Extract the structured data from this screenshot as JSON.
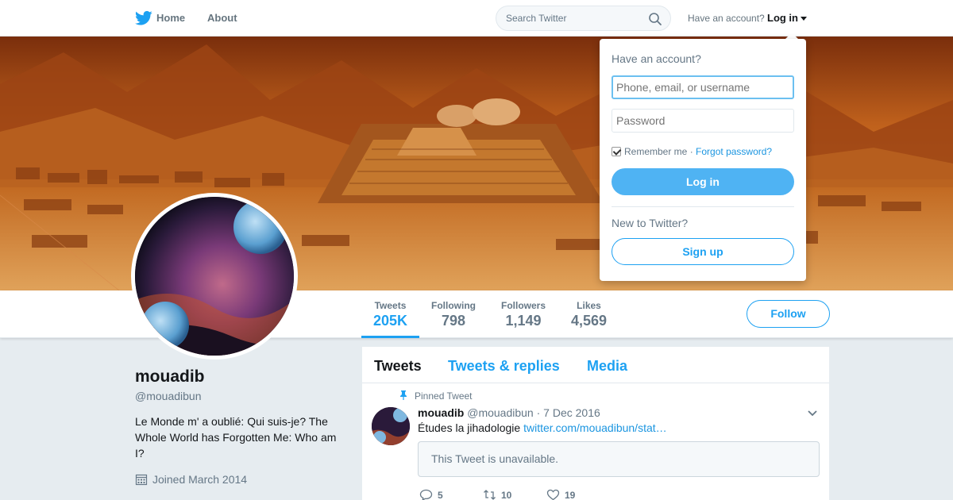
{
  "nav": {
    "home_label": "Home",
    "about_label": "About",
    "search_placeholder": "Search Twitter",
    "have_account": "Have an account?",
    "login_label": "Log in"
  },
  "profile": {
    "name": "mouadib",
    "handle": "@mouadibun",
    "bio": "Le Monde m' a oublié: Qui suis-je? The Whole World has Forgotten Me: Who am I?",
    "joined": "Joined March 2014",
    "follow_label": "Follow",
    "stats": [
      {
        "label": "Tweets",
        "value": "205K"
      },
      {
        "label": "Following",
        "value": "798"
      },
      {
        "label": "Followers",
        "value": "1,149"
      },
      {
        "label": "Likes",
        "value": "4,569"
      }
    ]
  },
  "timeline": {
    "tabs": [
      "Tweets",
      "Tweets & replies",
      "Media"
    ],
    "pinned_label": "Pinned Tweet",
    "tweet": {
      "name": "mouadib",
      "handle": "@mouadibun",
      "date": "· 7 Dec 2016",
      "text": "Études la jihadologie",
      "link": "twitter.com/mouadibun/stat…",
      "unavailable": "This Tweet is unavailable.",
      "replies": "5",
      "retweets": "10",
      "likes": "19"
    }
  },
  "login_dropdown": {
    "title": "Have an account?",
    "username_placeholder": "Phone, email, or username",
    "password_placeholder": "Password",
    "remember_me": "Remember me",
    "separator": "·",
    "forgot_password": "Forgot password?",
    "login_button": "Log in",
    "new_to_twitter": "New to Twitter?",
    "signup_button": "Sign up"
  },
  "colors": {
    "accent": "#1da1f2",
    "background": "#e6ecf0",
    "login_button": "#4fb3f3"
  }
}
